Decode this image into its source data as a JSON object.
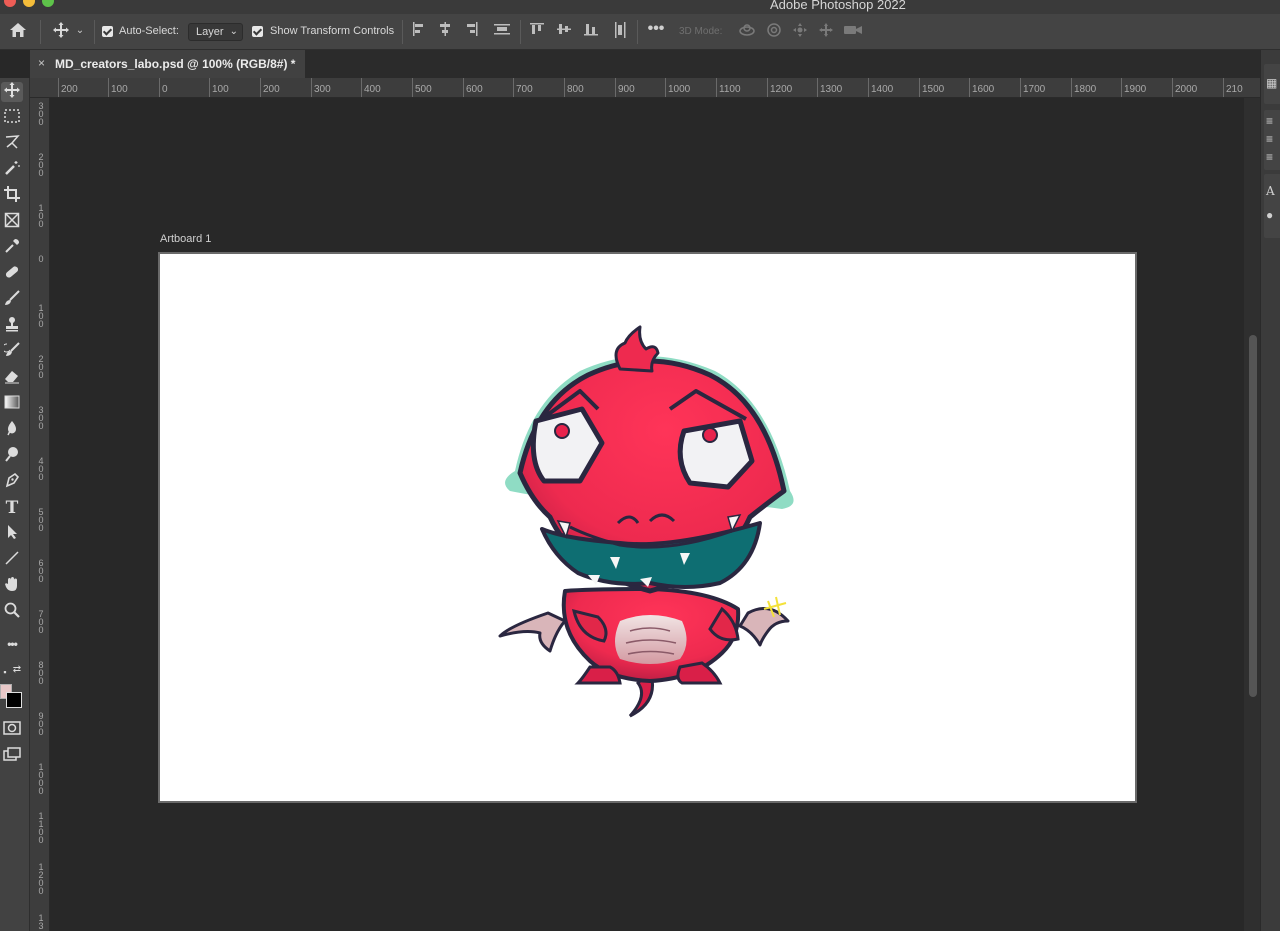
{
  "window": {
    "app_title": "Adobe Photoshop 2022"
  },
  "options_bar": {
    "home_icon": "home-icon",
    "move_icon": "move-tool-icon",
    "auto_select_label": "Auto-Select:",
    "auto_select_checked": true,
    "auto_select_value": "Layer",
    "show_transform_label": "Show Transform Controls",
    "show_transform_checked": true,
    "more_icon": "more-horizontal-icon",
    "mode_label": "3D Mode:"
  },
  "document_tab": {
    "close_glyph": "×",
    "title": "MD_creators_labo.psd @ 100% (RGB/8#) *"
  },
  "ruler": {
    "horizontal": [
      "200",
      "100",
      "0",
      "100",
      "200",
      "300",
      "400",
      "500",
      "600",
      "700",
      "800",
      "900",
      "1000",
      "1100",
      "1200",
      "1300",
      "1400",
      "1500",
      "1600",
      "1700",
      "1800",
      "1900",
      "2000",
      "210"
    ],
    "vertical": [
      "300",
      "200",
      "100",
      "0",
      "100",
      "200",
      "300",
      "400",
      "500",
      "600",
      "700",
      "800",
      "900",
      "1000",
      "1100",
      "1200",
      "13"
    ]
  },
  "canvas": {
    "artboard_label": "Artboard 1",
    "background": "#282828",
    "artboard_color": "#ffffff"
  },
  "colors": {
    "foreground": "#e8c8c8",
    "background": "#000000",
    "dragon_body": "#ee2a4f",
    "dragon_mouth": "#0e6e72",
    "dragon_rim": "#8fdcc4"
  },
  "tools": [
    "move",
    "marquee",
    "lasso",
    "magic-wand",
    "crop",
    "frame",
    "eyedropper",
    "healing",
    "brush",
    "stamp",
    "history-brush",
    "eraser",
    "gradient",
    "blur",
    "dodge",
    "pen",
    "type",
    "path-select",
    "line",
    "hand",
    "zoom",
    "more"
  ]
}
